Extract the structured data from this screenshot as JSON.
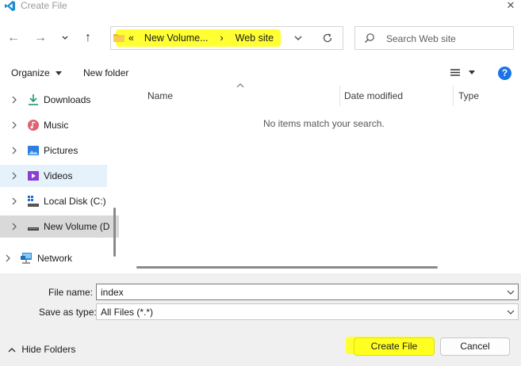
{
  "window": {
    "title": "Create File",
    "close_symbol": "✕"
  },
  "nav": {
    "back_symbol": "←",
    "forward_symbol": "→",
    "recent_symbol": "⌄",
    "up_symbol": "↑"
  },
  "address": {
    "overflow": "«",
    "crumbs": [
      "New Volume...",
      "Web site"
    ],
    "separator": "›"
  },
  "search": {
    "placeholder": "Search Web site"
  },
  "toolbar": {
    "organize_label": "Organize",
    "new_folder_label": "New folder",
    "help_symbol": "?"
  },
  "sidebar": {
    "items": [
      {
        "label": "Downloads",
        "icon": "download-icon"
      },
      {
        "label": "Music",
        "icon": "music-icon"
      },
      {
        "label": "Pictures",
        "icon": "pictures-icon"
      },
      {
        "label": "Videos",
        "icon": "videos-icon"
      },
      {
        "label": "Local Disk (C:)",
        "icon": "drive-icon"
      },
      {
        "label": "New Volume (D",
        "icon": "drive-icon"
      },
      {
        "label": "Network",
        "icon": "network-icon"
      }
    ]
  },
  "filelist": {
    "columns": [
      "Name",
      "Date modified",
      "Type"
    ],
    "empty_message": "No items match your search."
  },
  "form": {
    "file_name_label": "File name:",
    "file_name_value": "index",
    "save_as_label": "Save as type:",
    "save_as_value": "All Files (*.*)"
  },
  "footer": {
    "hide_folders_label": "Hide Folders",
    "create_label": "Create File",
    "cancel_label": "Cancel"
  },
  "colors": {
    "highlight": "#ffff33",
    "accent": "#1a73e8",
    "selection": "#d9d9d9",
    "hover": "#e5f1fb"
  }
}
